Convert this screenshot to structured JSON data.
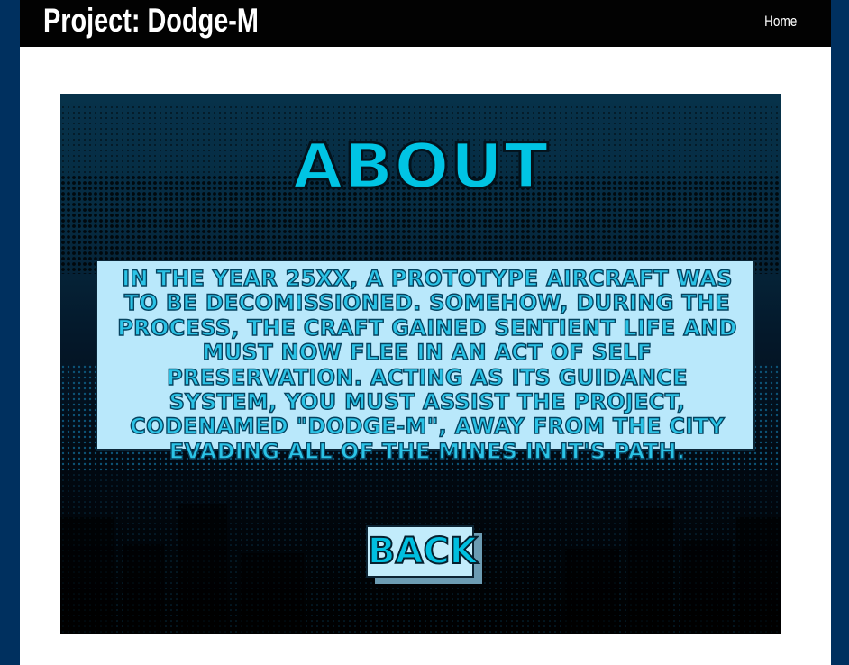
{
  "navbar": {
    "brand": "Project: Dodge-M",
    "home_link": "Home"
  },
  "about_screen": {
    "heading": "ABOUT",
    "story": "In the year 25XX, a prototype aircraft was to be decomissioned. Somehow, during the process, the craft gained sentient life and must now flee in an act of self preservation. Acting as its guidance system, you must assist the project, codenamed \"Dodge-M\", away from the city evading all of the mines in it's path.",
    "back_button": "BACK"
  },
  "colors": {
    "page_background": "#00305f",
    "navbar_background": "#020202",
    "panel_background": "#b9e8fb",
    "title_cyan": "#00c4e4",
    "sky_top": "#06324a"
  }
}
